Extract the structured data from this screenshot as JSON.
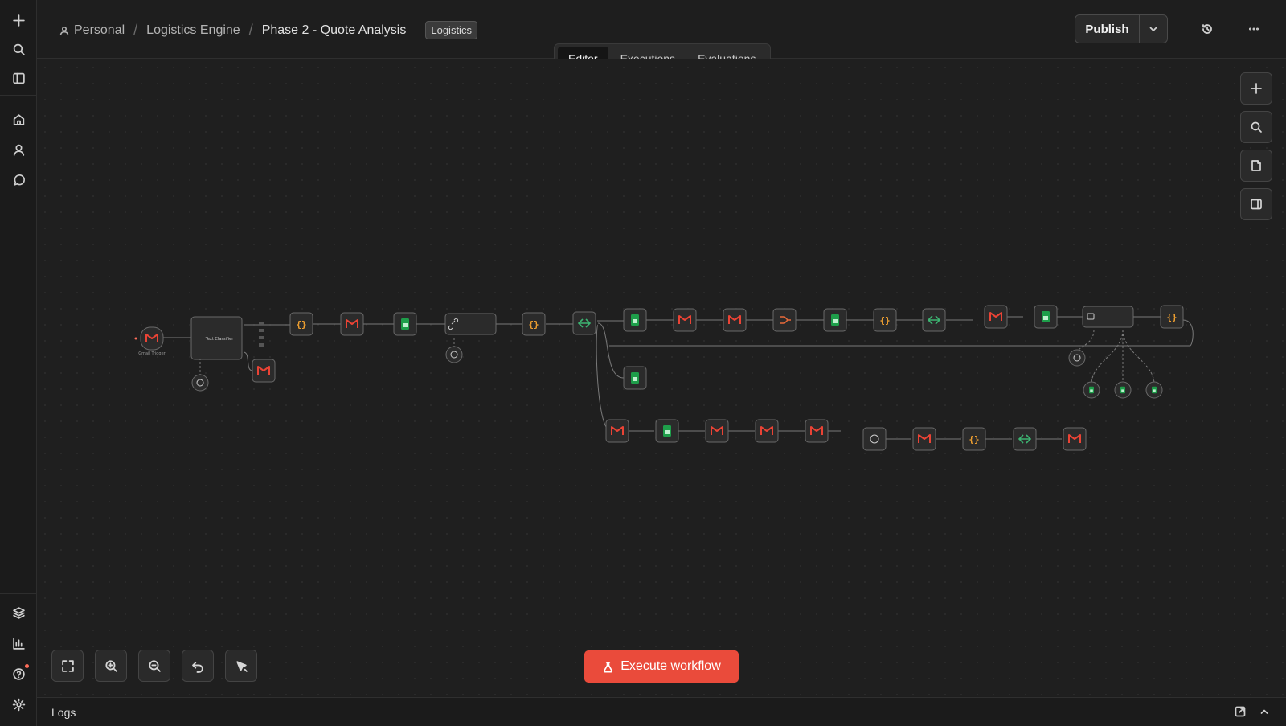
{
  "breadcrumb": {
    "items": [
      "Personal",
      "Logistics Engine",
      "Phase 2 - Quote Analysis"
    ],
    "tag": "Logistics"
  },
  "header": {
    "publish_label": "Publish"
  },
  "tabs": [
    {
      "label": "Editor",
      "active": true
    },
    {
      "label": "Executions",
      "active": false
    },
    {
      "label": "Evaluations",
      "active": false
    }
  ],
  "execute_label": "Execute workflow",
  "logs_label": "Logs",
  "colors": {
    "accent": "#ea4b3b",
    "gmail_red": "#ea4335",
    "sheets_green": "#1e9e4a",
    "code_orange": "#f0a030",
    "if_green": "#3cb371"
  },
  "icons": {
    "sidebar_top": [
      "plus-icon",
      "search-icon",
      "sidebar-toggle-icon"
    ],
    "sidebar_nav": [
      "home-icon",
      "user-icon",
      "chat-icon"
    ],
    "sidebar_bottom": [
      "templates-icon",
      "insights-icon",
      "help-icon",
      "settings-icon"
    ],
    "canvas_right": [
      "plus-icon",
      "search-icon",
      "sticky-note-icon",
      "panel-icon"
    ],
    "canvas_bottom": [
      "fit-view-icon",
      "zoom-in-icon",
      "zoom-out-icon",
      "undo-icon",
      "tidy-up-icon"
    ]
  }
}
